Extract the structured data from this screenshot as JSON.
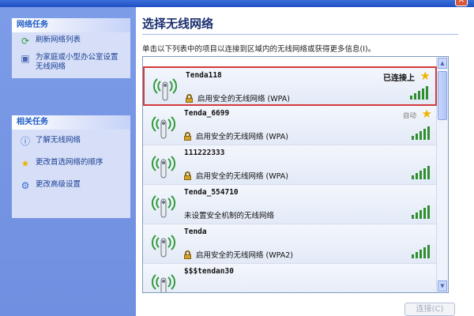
{
  "window": {
    "close_glyph": "×"
  },
  "sidebar": {
    "network_tasks": {
      "header": "网络任务",
      "items": [
        {
          "label": "刷新网络列表",
          "icon": "refresh-icon"
        },
        {
          "label": "为家庭或小型办公室设置无线网络",
          "icon": "network-setup-icon"
        }
      ]
    },
    "related_tasks": {
      "header": "相关任务",
      "items": [
        {
          "label": "了解无线网络",
          "icon": "info-icon"
        },
        {
          "label": "更改首选网络的顺序",
          "icon": "star-icon"
        },
        {
          "label": "更改高级设置",
          "icon": "settings-icon"
        }
      ]
    }
  },
  "main": {
    "title": "选择无线网络",
    "instruction": "单击以下列表中的项目以连接到区域内的无线网络或获得更多信息(I)。",
    "networks": [
      {
        "name": "Tenda118",
        "security": "启用安全的无线网络 (WPA)",
        "status": "已连接上",
        "starred": true,
        "selected": true
      },
      {
        "name": "Tenda_6699",
        "security": "启用安全的无线网络 (WPA)",
        "status": "自动",
        "starred": true,
        "selected": false
      },
      {
        "name": "111222333",
        "security": "启用安全的无线网络 (WPA)",
        "status": "",
        "starred": false,
        "selected": false
      },
      {
        "name": "Tenda_554710",
        "security": "未设置安全机制的无线网络",
        "status": "",
        "starred": false,
        "selected": false
      },
      {
        "name": "Tenda",
        "security": "启用安全的无线网络 (WPA2)",
        "status": "",
        "starred": false,
        "selected": false
      },
      {
        "name": "$$$tendan30",
        "security": "",
        "status": "",
        "starred": false,
        "selected": false
      }
    ],
    "connect_button": "连接(C)"
  },
  "colors": {
    "accent": "#215dc6",
    "selection_border": "#d23b3b",
    "signal": "#2f8f2f"
  }
}
